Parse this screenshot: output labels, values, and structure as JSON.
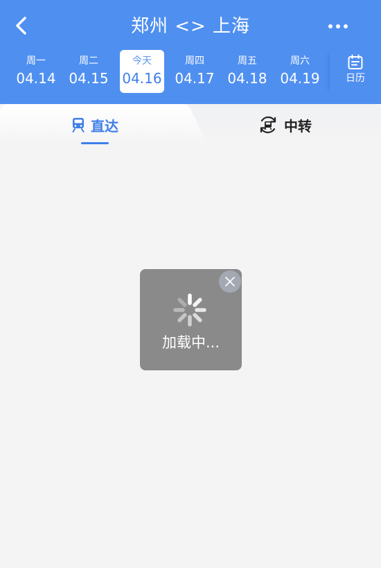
{
  "header": {
    "title": "郑州 <> 上海",
    "back_icon": "chevron-left-icon",
    "more_icon": "more-horizontal-icon",
    "background_color": "#4f8ff0"
  },
  "dates": [
    {
      "weekday": "周一",
      "date": "04.14",
      "active": false
    },
    {
      "weekday": "周二",
      "date": "04.15",
      "active": false
    },
    {
      "weekday": "今天",
      "date": "04.16",
      "active": true
    },
    {
      "weekday": "周四",
      "date": "04.17",
      "active": false
    },
    {
      "weekday": "周五",
      "date": "04.18",
      "active": false
    },
    {
      "weekday": "周六",
      "date": "04.19",
      "active": false
    }
  ],
  "calendar": {
    "label": "日历",
    "icon": "calendar-icon"
  },
  "tabs": [
    {
      "label": "直达",
      "icon": "train-icon",
      "active": true
    },
    {
      "label": "中转",
      "icon": "transfer-icon",
      "active": false
    }
  ],
  "loading": {
    "text": "加载中...",
    "close_icon": "close-icon"
  },
  "colors": {
    "accent": "#3d7fe8",
    "page_background": "#f4f4f5",
    "toast_background": "#8a8a8a"
  }
}
